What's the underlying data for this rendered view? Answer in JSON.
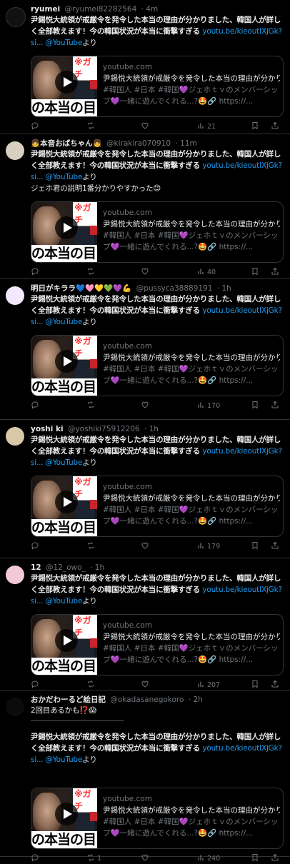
{
  "tweets": [
    {
      "name": "ryumei",
      "handle": "@ryumei82282564",
      "time": "· 4m",
      "text_bold": "尹錫悦大統領が戒厳令を発令した本当の理由が分かりました、韓国人が詳しく全部教えます！今の韓国状況が本当に衝撃すぎる",
      "link": "youtu.be/kieoutIXjGk?si...",
      "mention": "@YouTube",
      "suffix": "より",
      "extra": "",
      "views": "21"
    },
    {
      "name": "👧本音おばちゃん👧",
      "handle": "@kirakira070910",
      "time": "· 11m",
      "text_bold": "尹錫悦大統領が戒厳令を発令した本当の理由が分かりました、韓国人が詳しく全部教えます！今の韓国状況が本当に衝撃すぎる",
      "link": "youtu.be/kieoutIXjGk?si...",
      "mention": "@YouTube",
      "suffix": "より",
      "extra": "ジェホ君の説明1番分かりやすかった😊",
      "views": "40"
    },
    {
      "name": "明日がキララ💙🩷💛💚💜💪",
      "handle": "@pussyca38889191",
      "time": "· 1h",
      "text_bold": "尹錫悦大統領が戒厳令を発令した本当の理由が分かりました、韓国人が詳しく全部教えます！今の韓国状況が本当に衝撃すぎる",
      "link": "youtu.be/kieoutIXjGk?si...",
      "mention": "@YouTube",
      "suffix": "より",
      "extra": "",
      "views": "170"
    },
    {
      "name": "yoshi ki",
      "handle": "@yoshiki75912206",
      "time": "· 1h",
      "text_bold": "尹錫悦大統領が戒厳令を発令した本当の理由が分かりました、韓国人が詳しく全部教えます！今の韓国状況が本当に衝撃すぎる",
      "link": "youtu.be/kieoutIXjGk?si...",
      "mention": "@YouTube",
      "suffix": "より",
      "extra": "",
      "views": "179"
    },
    {
      "name": "12",
      "handle": "@12_owo_",
      "time": "· 1h",
      "text_bold": "尹錫悦大統領が戒厳令を発令した本当の理由が分かりました、韓国人が詳しく全部教えます！今の韓国状況が本当に衝撃すぎる",
      "link": "youtu.be/kieoutIXjGk?si...",
      "mention": "@YouTube",
      "suffix": "より",
      "extra": "",
      "views": "207"
    },
    {
      "name": "おかだわーるど絵日記",
      "handle": "@okadasanegokoro",
      "time": "· 2h",
      "text_bold": "尹錫悦大統領が戒厳令を発令した本当の理由が分かりました、韓国人が詳しく全部教えます！今の韓国状況が本当に衝撃すぎる",
      "link": "youtu.be/kieoutIXjGk?si...",
      "mention": "@YouTube",
      "suffix": "より",
      "extra": "2回目あるかも⁉️😱",
      "views": "240",
      "retweets": "1"
    }
  ],
  "card": {
    "domain": "youtube.com",
    "title": "尹錫悦大統領が戒厳令を発令した本当の理由が分かり…",
    "desc": "#韓国人 #日本 #韓国💜ジェホｔｖのメンバーシップ💜一緒に遊んでくれる...?🤩🔗 https://...",
    "thumb_red": "※ガチ",
    "thumb_big": "の本当の目"
  },
  "icons": [
    "reply-icon",
    "retweet-icon",
    "like-icon",
    "views-icon",
    "bookmark-icon",
    "share-icon"
  ]
}
